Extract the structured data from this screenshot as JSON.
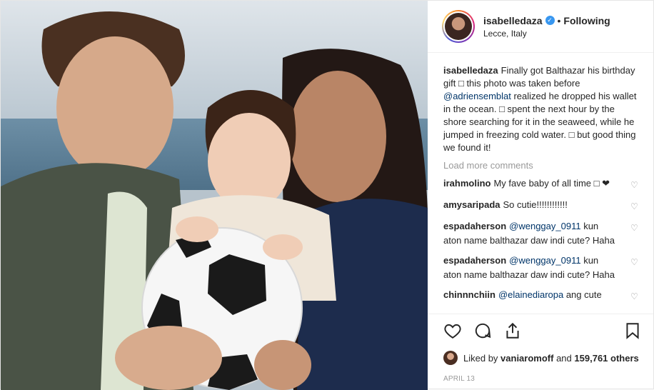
{
  "post": {
    "username": "isabelledaza",
    "follow_status": "Following",
    "separator": "•",
    "location": "Lecce, Italy",
    "caption": {
      "username": "isabelledaza",
      "text_1": "Finally got Balthazar his birthday gift ",
      "emoji_1": "□",
      "text_2": " this photo was taken before ",
      "mention": "@adriensemblat",
      "text_3": " realized he dropped his wallet in the ocean. ",
      "emoji_2": "□",
      "text_4": " spent the next hour by the shore searching for it in the seaweed, while he jumped in freezing cold water. ",
      "emoji_3": "□",
      "text_5": " but good thing we found it!"
    },
    "load_more": "Load more comments",
    "comments": [
      {
        "user": "irahmolino",
        "text": "My fave baby of all time □ ❤",
        "mention": ""
      },
      {
        "user": "amysaripada",
        "text": "So cutie!!!!!!!!!!!!",
        "mention": ""
      },
      {
        "user": "espadaherson",
        "mention": "@wenggay_0911",
        "text": " kun aton name balthazar daw indi cute? Haha"
      },
      {
        "user": "espadaherson",
        "mention": "@wenggay_0911",
        "text": " kun aton name balthazar daw indi cute? Haha"
      },
      {
        "user": "chinnnchiin",
        "mention": "@elainediaropa",
        "text": " ang cute"
      }
    ],
    "likes": {
      "prefix": "Liked by ",
      "user": "vaniaromoff",
      "middle": " and ",
      "count": "159,761 others"
    },
    "date": "APRIL 13"
  },
  "colors": {
    "accent": "#3897f0",
    "mention": "#003569",
    "muted": "#999999"
  },
  "icons": [
    "verified-badge-icon",
    "heart-icon",
    "comment-icon",
    "share-icon",
    "bookmark-icon"
  ]
}
